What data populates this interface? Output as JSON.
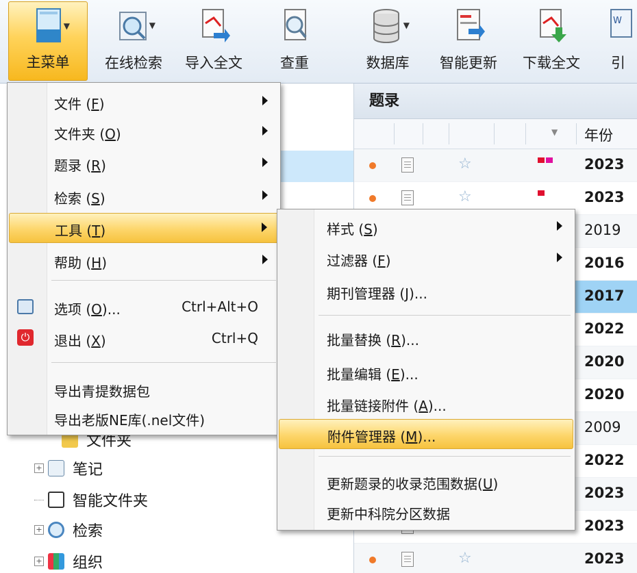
{
  "toolbar": {
    "buttons": [
      {
        "label": "主菜单",
        "icon": "main-menu-icon"
      },
      {
        "label": "在线检索",
        "icon": "online-search-icon"
      },
      {
        "label": "导入全文",
        "icon": "import-fulltext-icon"
      },
      {
        "label": "查重",
        "icon": "dedupe-icon"
      },
      {
        "label": "数据库",
        "icon": "database-icon"
      },
      {
        "label": "智能更新",
        "icon": "smart-update-icon"
      },
      {
        "label": "下载全文",
        "icon": "download-fulltext-icon"
      },
      {
        "label": "引",
        "icon": "cite-word-icon"
      }
    ]
  },
  "main_menu": {
    "items": [
      {
        "label": "文件 (",
        "key": "F",
        "tail": ")"
      },
      {
        "label": "文件夹 (",
        "key": "O",
        "tail": ")"
      },
      {
        "label": "题录 (",
        "key": "R",
        "tail": ")"
      },
      {
        "label": "检索 (",
        "key": "S",
        "tail": ")"
      },
      {
        "label": "工具 (",
        "key": "T",
        "tail": ")"
      },
      {
        "label": "帮助 (",
        "key": "H",
        "tail": ")"
      },
      {
        "label": "选项 (",
        "key": "O",
        "tail": ")...",
        "shortcut": "Ctrl+Alt+O"
      },
      {
        "label": "退出 (",
        "key": "X",
        "tail": ")",
        "shortcut": "Ctrl+Q"
      },
      {
        "label": "导出青提数据包"
      },
      {
        "label": "导出老版NE库(.nel文件)"
      }
    ]
  },
  "tools_menu": {
    "items": [
      {
        "label": "样式 (",
        "key": "S",
        "tail": ")"
      },
      {
        "label": "过滤器 (",
        "key": "F",
        "tail": ")"
      },
      {
        "label": "期刊管理器 (",
        "key": "J",
        "tail": ")..."
      },
      {
        "label": "批量替换 (",
        "key": "R",
        "tail": ")..."
      },
      {
        "label": "批量编辑 (",
        "key": "E",
        "tail": ")..."
      },
      {
        "label": "批量链接附件 (",
        "key": "A",
        "tail": ")..."
      },
      {
        "label": "附件管理器 (",
        "key": "M",
        "tail": ")..."
      },
      {
        "label": "更新题录的收录范围数据(",
        "key": "U",
        "tail": ")"
      },
      {
        "label": "更新中科院分区数据"
      }
    ]
  },
  "tree": {
    "items": [
      {
        "label": "文件夹"
      },
      {
        "label": "笔记"
      },
      {
        "label": "智能文件夹"
      },
      {
        "label": "检索"
      },
      {
        "label": "组织"
      }
    ]
  },
  "list": {
    "title": "题录",
    "year_header": "年份",
    "rows": [
      {
        "year": "2023",
        "tags": [
          "#e0102f",
          "#e0109f"
        ]
      },
      {
        "year": "2023",
        "tags": [
          "#e0102f"
        ]
      },
      {
        "year": "2019",
        "tags": []
      },
      {
        "year": "2016",
        "tags": []
      },
      {
        "year": "2017",
        "tags": []
      },
      {
        "year": "2022",
        "tags": []
      },
      {
        "year": "2020",
        "tags": []
      },
      {
        "year": "2020",
        "tags": []
      },
      {
        "year": "2009",
        "tags": []
      },
      {
        "year": "2022",
        "tags": []
      },
      {
        "year": "2023",
        "tags": []
      },
      {
        "year": "2023",
        "tags": []
      },
      {
        "year": "2023",
        "tags": []
      }
    ]
  },
  "colors": {
    "highlight": "#fdd66b",
    "selection_row": "#9fd3f5",
    "status_dot": "#f07a2a"
  }
}
